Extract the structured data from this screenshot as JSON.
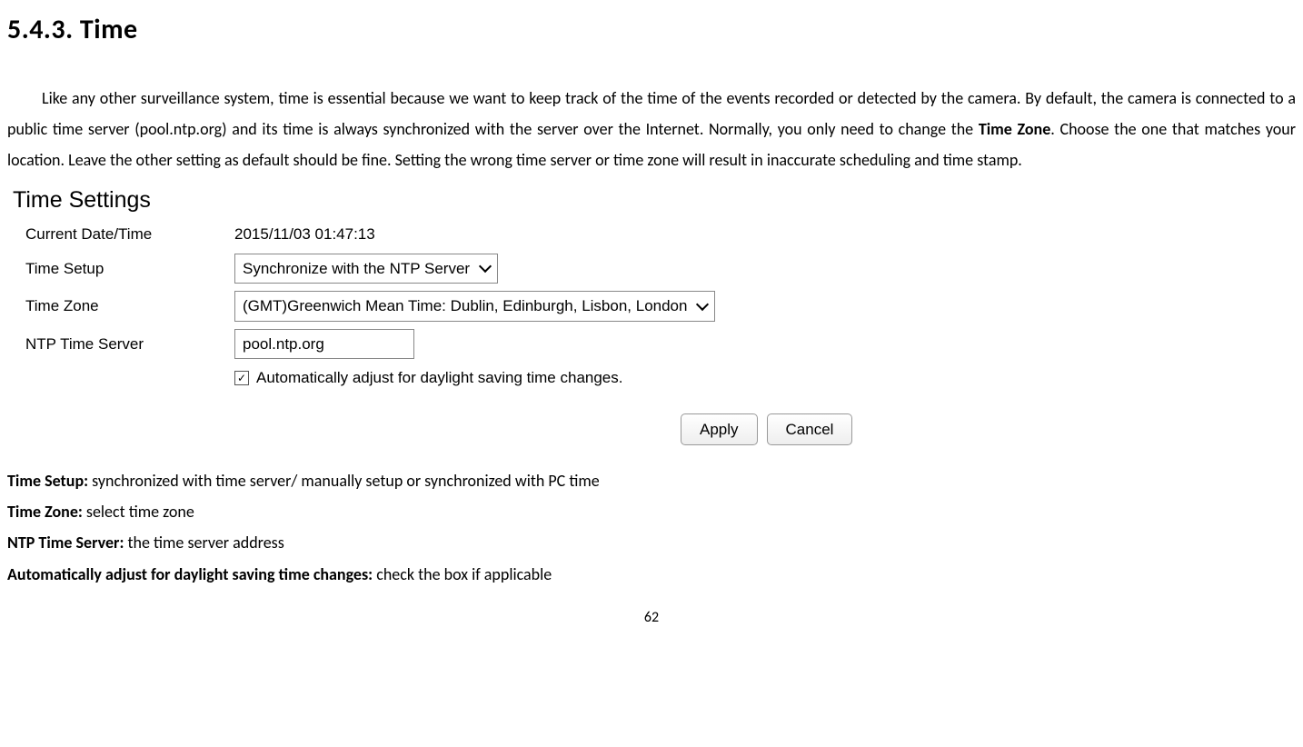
{
  "heading": "5.4.3.   Time",
  "para_before": "Like any other surveillance system, time is essential because we want to keep track of the time of the events recorded or detected by the camera. By default, the camera is connected to a public time server (pool.ntp.org) and its time is always synchronized with the server over the Internet. Normally, you only need to change the ",
  "para_bold": "Time Zone",
  "para_after": ". Choose the one that matches your location. Leave the other setting as default should be fine. Setting the wrong time server or time zone will result in inaccurate scheduling and time stamp.",
  "figure": {
    "title": "Time Settings",
    "rows": {
      "current_label": "Current Date/Time",
      "current_value": "2015/11/03 01:47:13",
      "setup_label": "Time Setup",
      "setup_value": "Synchronize with the NTP Server",
      "zone_label": "Time Zone",
      "zone_value": "(GMT)Greenwich Mean Time: Dublin, Edinburgh, Lisbon, London",
      "ntp_label": "NTP Time Server",
      "ntp_value": "pool.ntp.org",
      "dst_label": "Automatically adjust for daylight saving time changes."
    },
    "buttons": {
      "apply": "Apply",
      "cancel": "Cancel"
    }
  },
  "defs": {
    "d1_label": "Time Setup:",
    "d1_text": " synchronized with time server/ manually setup or synchronized with PC time",
    "d2_label": "Time Zone:",
    "d2_text": " select time zone",
    "d3_label": "NTP Time Server:",
    "d3_text": " the time server address",
    "d4_label": "Automatically adjust for daylight saving time changes:",
    "d4_text": " check the box if applicable"
  },
  "page_number": "62"
}
